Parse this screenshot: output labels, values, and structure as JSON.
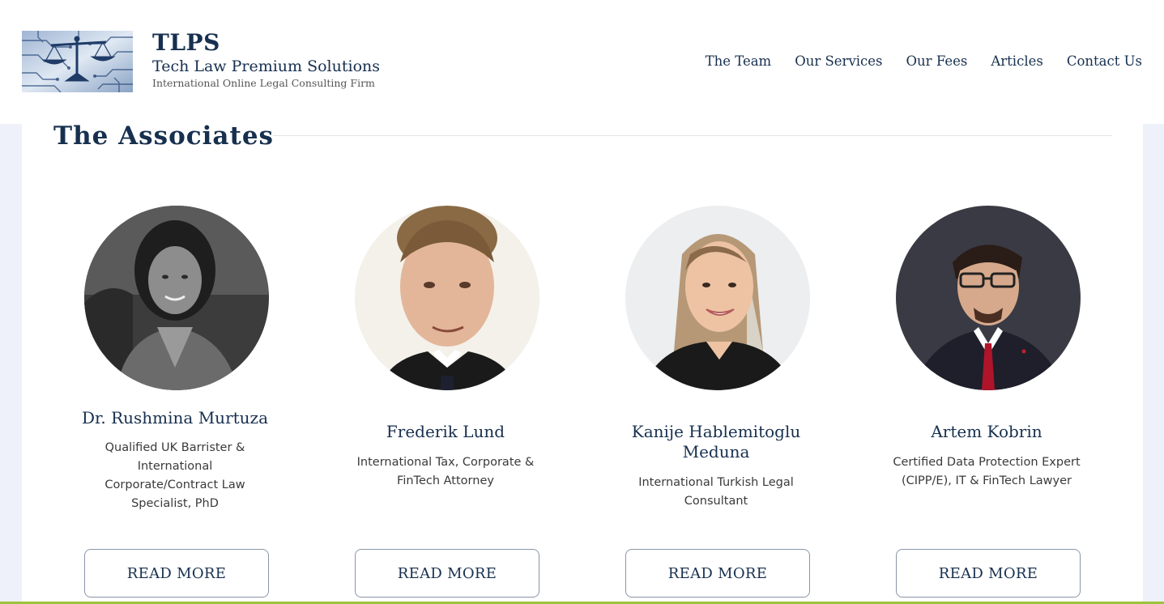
{
  "header": {
    "logo_alt": "logo-scales-of-justice-icon",
    "title": "TLPS",
    "subtitle": "Tech Law Premium Solutions",
    "tagline": "International Online Legal Consulting Firm"
  },
  "nav": {
    "items": [
      {
        "label": "The Team"
      },
      {
        "label": "Our Services"
      },
      {
        "label": "Our Fees"
      },
      {
        "label": "Articles"
      },
      {
        "label": "Contact Us"
      }
    ]
  },
  "main": {
    "section_title": "The Associates",
    "associates": [
      {
        "name": "Dr. Rushmina Murtuza",
        "description": "Qualified UK Barrister & International Corporate/Contract Law Specialist, PhD",
        "button_label": "READ MORE"
      },
      {
        "name": "Frederik Lund",
        "description": "International Tax, Corporate & FinTech Attorney",
        "button_label": "READ MORE"
      },
      {
        "name": "Kanije Hablemitoglu Meduna",
        "description": "International Turkish Legal Consultant",
        "button_label": "READ MORE"
      },
      {
        "name": "Artem Kobrin",
        "description": "Certified Data Protection Expert (CIPP/E), IT & FinTech Lawyer",
        "button_label": "READ MORE"
      }
    ]
  },
  "colors": {
    "brand_navy": "#17304f",
    "page_bg": "#eef1f9",
    "accent_green": "#9bc33c"
  }
}
